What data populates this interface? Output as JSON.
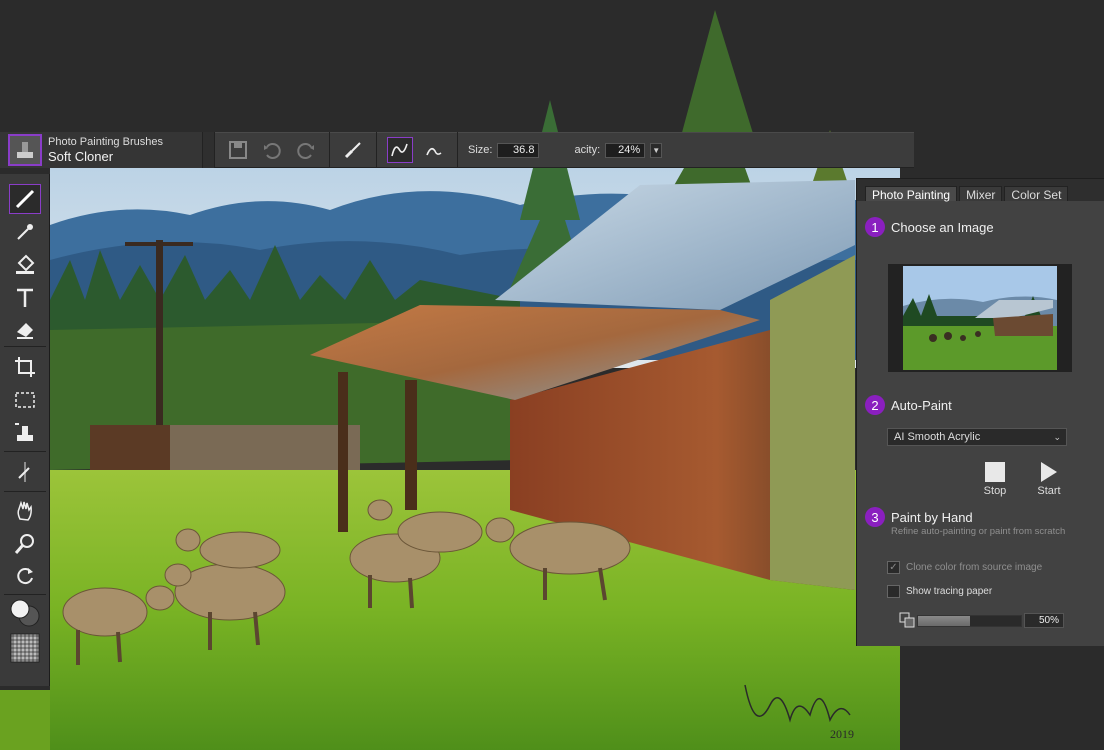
{
  "app": {
    "accent_color": "#8a3dc8"
  },
  "propbar": {
    "brush_category": "Photo Painting Brushes",
    "brush_name": "Soft Cloner",
    "size_label": "Size:",
    "size_value": "36.8",
    "opacity_label": "acity:",
    "opacity_value": "24%"
  },
  "toolbox": {
    "tools": [
      "brush-icon",
      "dropper-icon",
      "paint-bucket-icon",
      "text-icon",
      "eraser-icon",
      "crop-icon",
      "rect-select-icon",
      "cloner-icon",
      "symmetry-icon",
      "grabber-icon",
      "magnifier-icon",
      "rotate-icon",
      "color-swatch-icon",
      "paper-texture-icon"
    ]
  },
  "panel": {
    "tabs": [
      "Photo Painting",
      "Mixer",
      "Color Set"
    ],
    "step1": {
      "num": "1",
      "title": "Choose an Image"
    },
    "step2": {
      "num": "2",
      "title": "Auto-Paint"
    },
    "preset": "AI Smooth Acrylic",
    "stop_label": "Stop",
    "start_label": "Start",
    "step3": {
      "num": "3",
      "title": "Paint by Hand",
      "subtitle": "Refine auto-painting or paint from scratch"
    },
    "clone_color_label": "Clone color from source image",
    "tracing_label": "Show tracing paper",
    "tracing_opacity": "50%",
    "tracing_opacity_fraction": 0.5
  },
  "signature": {
    "year": "2019"
  }
}
